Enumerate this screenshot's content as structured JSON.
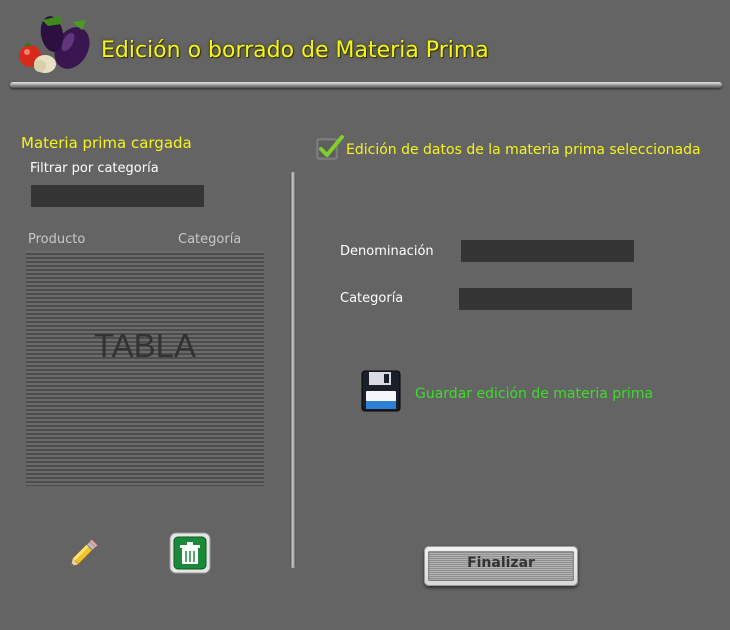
{
  "header": {
    "title": "Edición o borrado de Materia Prima",
    "logo_icon": "vegetables-logo-icon"
  },
  "left_panel": {
    "section_title": "Materia prima cargada",
    "filter_label": "Filtrar por categoría",
    "filter_value": "",
    "table": {
      "columns": [
        "Producto",
        "Categoría"
      ],
      "placeholder": "TABLA",
      "rows": []
    },
    "edit_icon": "pencil-icon",
    "delete_icon": "trash-icon"
  },
  "right_panel": {
    "edit_checkbox_label": "Edición de datos de la materia prima seleccionada",
    "edit_checkbox_checked": true,
    "fields": [
      {
        "label": "Denominación",
        "value": ""
      },
      {
        "label": "Categoría",
        "value": ""
      }
    ],
    "save_icon": "floppy-disk-icon",
    "save_label": "Guardar edición de materia prima",
    "finish_label": "Finalizar"
  },
  "colors": {
    "background": "#646464",
    "title": "#f4f41e",
    "save_label": "#3ddc2a",
    "input_bg": "#353535"
  }
}
